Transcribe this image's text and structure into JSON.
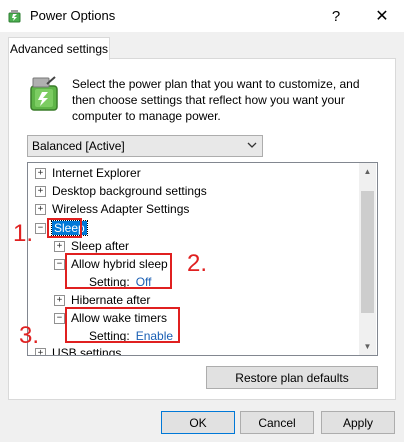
{
  "window": {
    "title": "Power Options",
    "help_label": "?",
    "close_label": "✕",
    "icon": "power-options-icon"
  },
  "tab": {
    "label": "Advanced settings"
  },
  "description": "Select the power plan that you want to customize, and then choose settings that reflect how you want your computer to manage power.",
  "plan_dropdown": {
    "selected": "Balanced [Active]"
  },
  "tree": {
    "expand_glyph": "+",
    "collapse_glyph": "−",
    "items": [
      {
        "label": "Internet Explorer"
      },
      {
        "label": "Desktop background settings"
      },
      {
        "label": "Wireless Adapter Settings"
      },
      {
        "label": "Sleep"
      },
      {
        "label": "Sleep after"
      },
      {
        "label": "Allow hybrid sleep",
        "setting_label": "Setting:",
        "setting_value": "Off"
      },
      {
        "label": "Hibernate after"
      },
      {
        "label": "Allow wake timers",
        "setting_label": "Setting:",
        "setting_value": "Enable"
      },
      {
        "label": "USB settings"
      }
    ]
  },
  "buttons": {
    "restore": "Restore plan defaults",
    "ok": "OK",
    "cancel": "Cancel",
    "apply": "Apply"
  },
  "annotations": {
    "one": "1.",
    "two": "2.",
    "three": "3.",
    "color": "#e02020"
  }
}
